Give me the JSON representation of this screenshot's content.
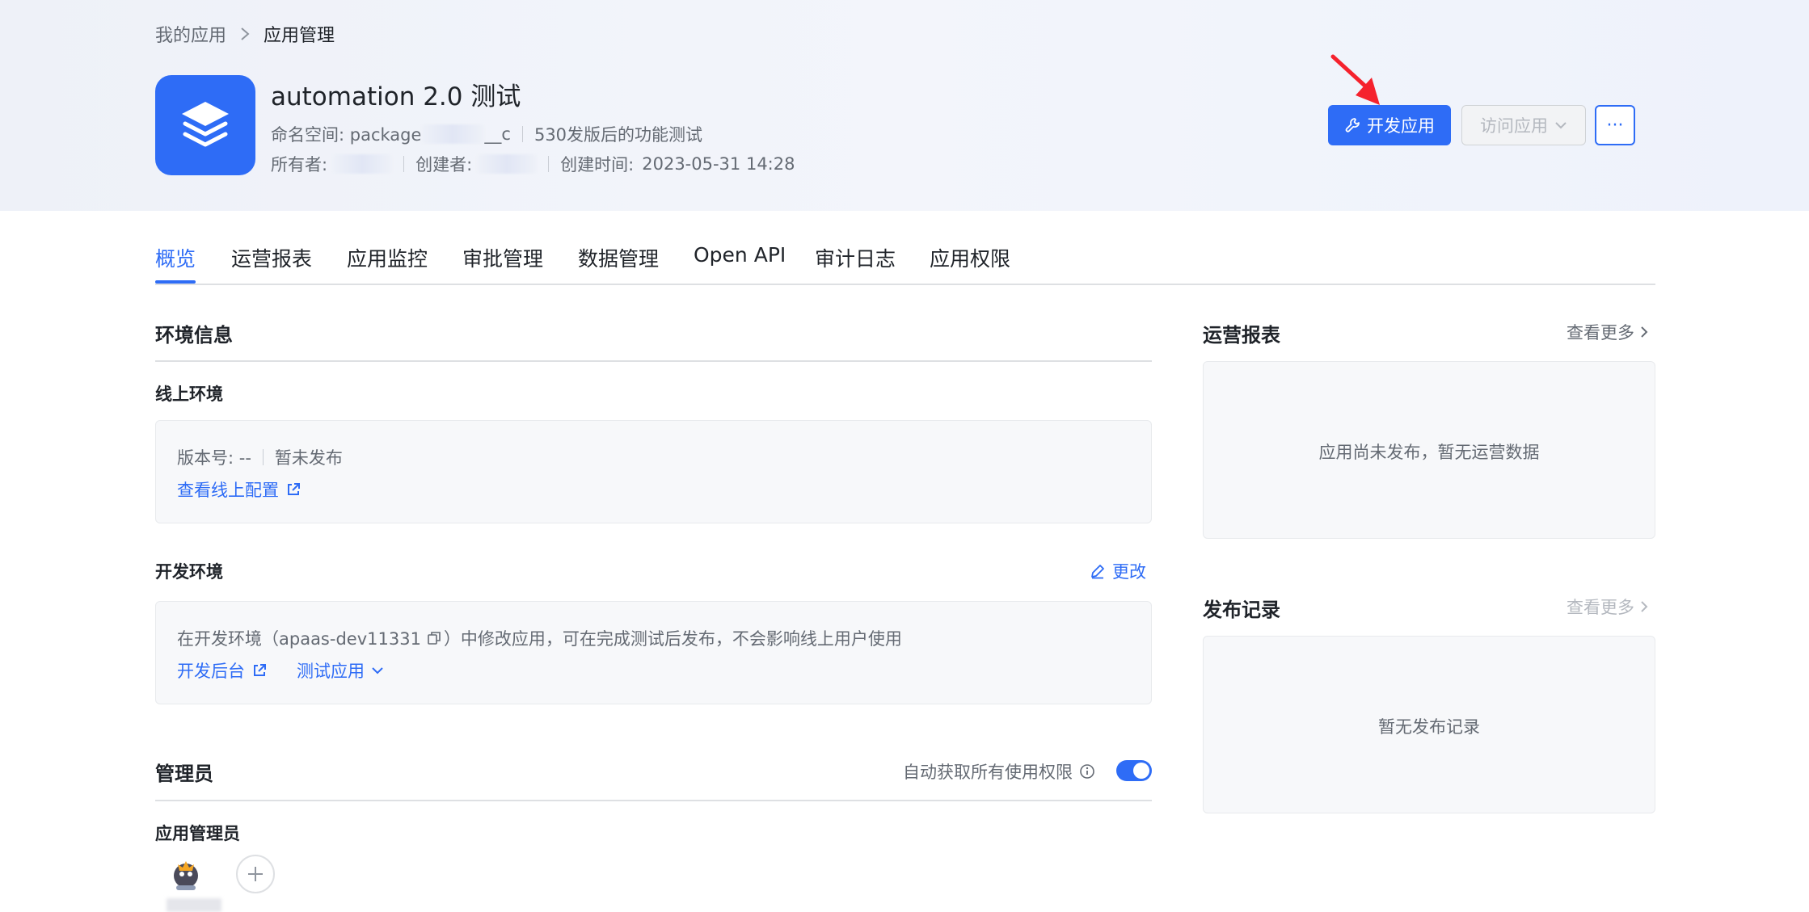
{
  "breadcrumb": {
    "parent": "我的应用",
    "current": "应用管理"
  },
  "app": {
    "title": "automation 2.0 测试",
    "namespace_label": "命名空间: package",
    "namespace_suffix": "__c",
    "description": "530发版后的功能测试",
    "owner_label": "所有者:",
    "creator_label": "创建者:",
    "created_label": "创建时间:",
    "created_value": "2023-05-31 14:28"
  },
  "actions": {
    "develop_label": "开发应用",
    "visit_label": "访问应用",
    "more_label": "···"
  },
  "tabs": [
    {
      "label": "概览"
    },
    {
      "label": "运营报表"
    },
    {
      "label": "应用监控"
    },
    {
      "label": "审批管理"
    },
    {
      "label": "数据管理"
    },
    {
      "label": "Open API"
    },
    {
      "label": "审计日志"
    },
    {
      "label": "应用权限"
    }
  ],
  "env": {
    "title": "环境信息",
    "online": {
      "title": "线上环境",
      "version_label": "版本号: --",
      "status": "暂未发布",
      "config_link": "查看线上配置"
    },
    "dev": {
      "title": "开发环境",
      "edit_label": "更改",
      "desc_prefix": "在开发环境（apaas-dev11331",
      "desc_suffix": "）中修改应用，可在完成测试后发布，不会影响线上用户使用",
      "console_link": "开发后台",
      "test_link": "测试应用"
    }
  },
  "admins": {
    "title": "管理员",
    "auto_perm_label": "自动获取所有使用权限",
    "sub_title": "应用管理员",
    "auto_perm_enabled": true
  },
  "ops_report": {
    "title": "运营报表",
    "more_label": "查看更多",
    "empty_text": "应用尚未发布，暂无运营数据"
  },
  "releases": {
    "title": "发布记录",
    "more_label": "查看更多",
    "empty_text": "暂无发布记录"
  },
  "colors": {
    "primary": "#2e6cf6",
    "annotation": "#f5222d"
  }
}
